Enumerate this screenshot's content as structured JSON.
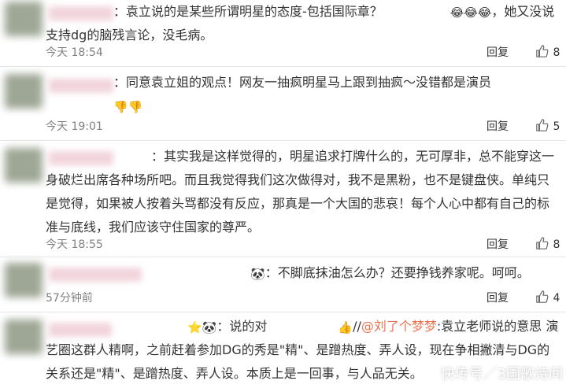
{
  "comments": [
    {
      "text_parts": {
        "body": "：袁立说的是某些所谓明星的态度-包括国际章？",
        "emojis": "😂😂😂",
        "tail": "，她又没说支持dg的脑残言论，没毛病。"
      },
      "time": "今天 18:54",
      "reply": "回复",
      "likes": "8"
    },
    {
      "text_parts": {
        "body": "：同意袁立姐的观点！网友一抽疯明星马上跟到抽疯～没错都是演员",
        "emojis": "👎👎",
        "tail": ""
      },
      "time": "今天 19:01",
      "reply": "回复",
      "likes": "5"
    },
    {
      "text_parts": {
        "body": "：其实我是这样觉得的，明星追求打牌什么的，无可厚非，总不能穿这一身破烂出席各种场所吧。而且我觉得我们这次做得对，我不是黑粉，也不是键盘侠。单纯只是觉得，如果被人按着头骂都没有反应，那真是一个大国的悲哀！每个人心中都有自己的标准与底线，我们应该守住国家的尊严。",
        "emojis": "",
        "tail": ""
      },
      "time": "今天 18:55",
      "reply": "回复",
      "likes": "8"
    },
    {
      "text_parts": {
        "pre_emoji": "🐼",
        "body": "：不脚底抹油怎么办？还要挣钱养家呢。呵呵。",
        "emojis": "",
        "tail": ""
      },
      "time": "57分钟前",
      "reply": "回复",
      "likes": "4"
    },
    {
      "text_parts": {
        "pre_emoji": "⭐🐼",
        "body_a": "：说的对",
        "mid_emoji": "👍",
        "slashes": "//",
        "mention": "@刘了个梦梦",
        "body_b": ":袁立老师说的意思 演艺圈这群人精啊，之前赶着参加DG的秀是\"精\"、是蹭热度、弄人设，现在争相撇清与DG的关系还是\"精\"、是蹭热度、弄人设。本质上是一回事，与人品无关。"
      }
    }
  ],
  "watermark": "快传号／3国歌诗间"
}
